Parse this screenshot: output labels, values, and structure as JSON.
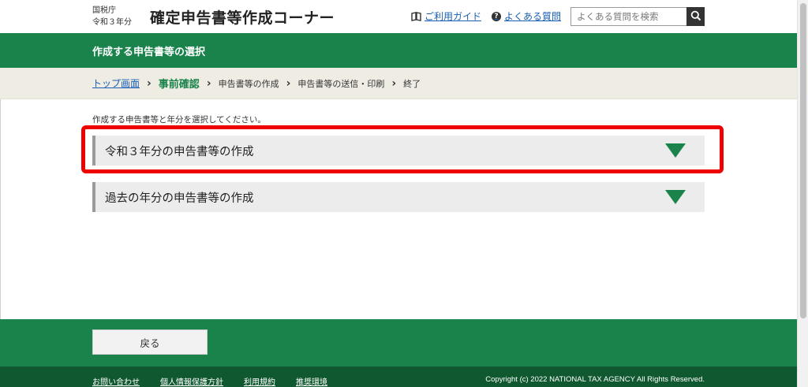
{
  "header": {
    "agency_line1": "国税庁",
    "agency_line2": "令和３年分",
    "site_title": "確定申告書等作成コーナー",
    "guide_link": "ご利用ガイド",
    "guide_icon": "book-icon",
    "faq_link": "よくある質問",
    "faq_icon": "question-circle-icon",
    "search": {
      "placeholder": "よくある質問を検索",
      "value": "",
      "button_icon": "search-icon"
    }
  },
  "page": {
    "title": "作成する申告書等の選択"
  },
  "breadcrumb": {
    "steps": [
      {
        "label": "トップ画面",
        "state": "link"
      },
      {
        "label": "事前確認",
        "state": "current"
      },
      {
        "label": "申告書等の作成",
        "state": "pending"
      },
      {
        "label": "申告書等の送信・印刷",
        "state": "pending"
      },
      {
        "label": "終了",
        "state": "pending"
      }
    ]
  },
  "main": {
    "instruction": "作成する申告書等と年分を選択してください。",
    "options": [
      {
        "label": "令和３年分の申告書等の作成",
        "icon": "triangle-down-icon",
        "highlighted": true
      },
      {
        "label": "過去の年分の申告書等の作成",
        "icon": "triangle-down-icon",
        "highlighted": false
      }
    ]
  },
  "footer": {
    "back_button": "戻る",
    "links": [
      "お問い合わせ",
      "個人情報保護方針",
      "利用規約",
      "推奨環境"
    ],
    "copyright": "Copyright (c) 2022 NATIONAL TAX AGENCY All Rights Reserved."
  },
  "colors": {
    "brand_green": "#19834b",
    "dark_green": "#10582f",
    "crumb_bg": "#efece3",
    "highlight_red": "#ee0000",
    "link_blue": "#1a5fb4"
  }
}
